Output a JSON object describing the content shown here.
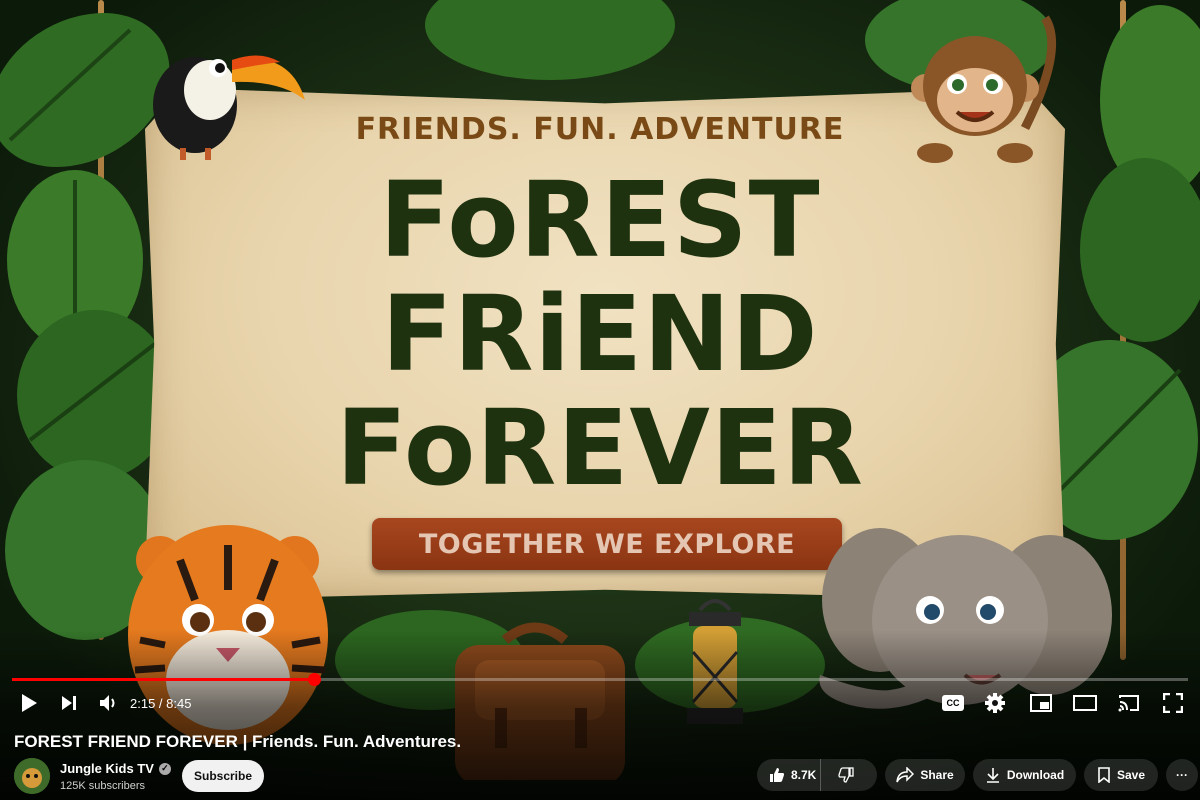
{
  "banner": {
    "tagline": "FRIENDS. FUN. ADVENTURE",
    "title_line1": "FoREST",
    "title_line2": "FRiEND",
    "title_line3": "FoREVER",
    "ribbon": "TOGETHER WE EXPLORE"
  },
  "player": {
    "time_display": "2:15 / 8:45",
    "progress_fraction": 0.257,
    "icons": {
      "play": "play-icon",
      "next": "next-icon",
      "volume": "volume-icon",
      "captions": "captions-icon",
      "settings": "gear-icon",
      "miniplayer": "miniplayer-icon",
      "theater": "theater-icon",
      "cast": "cast-icon",
      "fullscreen": "fullscreen-icon"
    },
    "captions_label": "CC"
  },
  "video": {
    "title": "FOREST FRIEND FOREVER | Friends. Fun. Adventures."
  },
  "channel": {
    "name": "Jungle Kids TV",
    "verified_mark": "✓",
    "subscribers": "125K subscribers",
    "subscribe_label": "Subscribe"
  },
  "actions": {
    "like_count": "8.7K",
    "share_label": "Share",
    "download_label": "Download",
    "save_label": "Save",
    "more_label": "···"
  },
  "colors": {
    "progress": "#ff0000",
    "banner_text": "#1f3210",
    "tagline": "#7a4a16",
    "ribbon": "#a8471f"
  }
}
